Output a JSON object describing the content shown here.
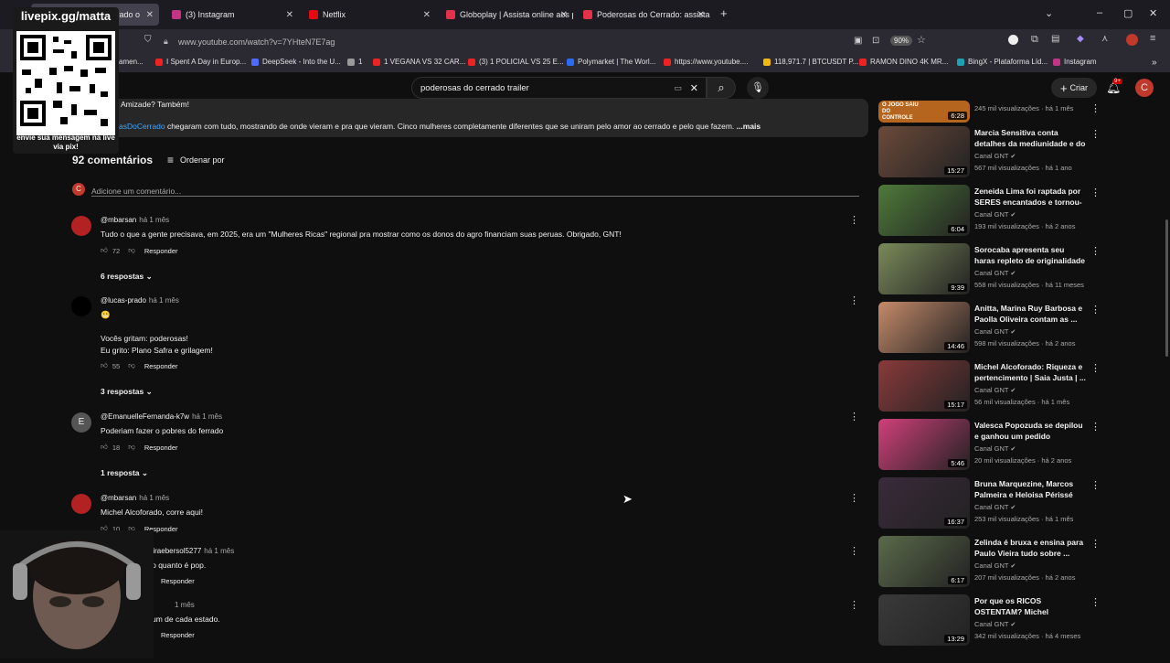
{
  "browser": {
    "tabs": [
      {
        "label": "Poderosas do Cerrado o",
        "color": "#5f5f5f",
        "active": true
      },
      {
        "label": "(3) Instagram",
        "color": "#c13584"
      },
      {
        "label": "Netflix",
        "color": "#e50914"
      },
      {
        "label": "Globoplay | Assista online aos p",
        "color": "#e1324a"
      },
      {
        "label": "Poderosas do Cerrado: assista a",
        "color": "#e1324a"
      }
    ],
    "url": "www.youtube.com/watch?v=7YHteN7E7ag",
    "zoom": "90%",
    "bookmarks": [
      "amen...",
      "I Spent A Day in Europ...",
      "DeepSeek - Into the U...",
      "1",
      "1 VEGANA VS 32 CAR...",
      "(3) 1 POLICIAL VS 25 E...",
      "Polymarket | The Worl...",
      "https://www.youtube....",
      "118,971.7 | BTCUSDT P...",
      "RAMON DINO 4K MR...",
      "BingX - Plataforma Líd...",
      "Instagram"
    ]
  },
  "youtube": {
    "search_value": "poderosas do cerrado trailer",
    "create_label": "Criar",
    "notifications": "9+",
    "avatar_letter": "C"
  },
  "description": {
    "line1": "Amizade? Também!",
    "hashtag": "asDoCerrado",
    "line2": "chegaram com tudo, mostrando de onde vieram e pra que vieram. Cinco mulheres completamente diferentes que se uniram pelo amor ao cerrado e pelo que fazem.",
    "more": "...mais"
  },
  "comments_header": {
    "count_label": "92 comentários",
    "sort_label": "Ordenar por",
    "add_placeholder": "Adicione um comentário..."
  },
  "comments": [
    {
      "author": "@mbarsan",
      "ago": "há 1 mês",
      "text": "Tudo o que a gente precisava, em 2025, era um \"Mulheres Ricas\" regional pra mostrar como os donos do agro financiam suas peruas. Obrigado, GNT!",
      "likes": "72",
      "reply": "Responder",
      "replies": "6 respostas"
    },
    {
      "author": "@lucas-prado",
      "ago": "há 1 mês",
      "text": "😬\n\nVocês gritam: poderosas!\nEu grito: Plano Safra e grilagem!",
      "likes": "55",
      "reply": "Responder",
      "replies": "3 respostas"
    },
    {
      "author": "@EmanuelleFernanda-k7w",
      "ago": "há 1 mês",
      "text": "Poderiam fazer o  pobres do ferrado",
      "likes": "18",
      "reply": "Responder",
      "replies": "1 resposta",
      "letter": "E"
    },
    {
      "author": "@mbarsan",
      "ago": "há 1 mês",
      "text": "Michel Alcoforado, corre aqui!",
      "likes": "10",
      "reply": "Responder"
    },
    {
      "author": "deoliveiraebersol5277",
      "ago": "há 1 mês",
      "text": "rando o quanto é pop.",
      "reply": "Responder"
    },
    {
      "author": "",
      "ago": "1 mês",
      "text": "um de cada estado.",
      "reply": "Responder"
    }
  ],
  "recommendations": [
    {
      "title": "O JOGO SAIU DO CONTROLE",
      "channel": "",
      "views": "245 mil visualizações · há 1 mês",
      "duration": "6:28",
      "color": "#b5651d"
    },
    {
      "title": "Marcia Sensitiva conta detalhes da mediunidade e do mundo ...",
      "channel": "Canal GNT",
      "views": "567 mil visualizações · há 1 ano",
      "duration": "15:27",
      "color": "#6b4a3a"
    },
    {
      "title": "Zeneida Lima foi raptada por SERES encantados e tornou-s...",
      "channel": "Canal GNT",
      "views": "193 mil visualizações · há 2 anos",
      "duration": "6:04",
      "color": "#4e7a3a"
    },
    {
      "title": "Sorocaba apresenta seu haras repleto de originalidade e afet...",
      "channel": "Canal GNT",
      "views": "558 mil visualizações · há 11 meses",
      "duration": "9:39",
      "color": "#7a8a5a"
    },
    {
      "title": "Anitta, Marina Ruy Barbosa e Paolla Oliveira contam as ...",
      "channel": "Canal GNT",
      "views": "598 mil visualizações · há 2 anos",
      "duration": "14:46",
      "color": "#c58a6a"
    },
    {
      "title": "Michel Alcoforado: Riqueza e pertencimento | Saia Justa | ...",
      "channel": "Canal GNT",
      "views": "56 mil visualizações · há 1 mês",
      "duration": "15:17",
      "color": "#8a3a3a"
    },
    {
      "title": "Valesca Popozuda se depilou e ganhou um pedido inusitado n...",
      "channel": "Canal GNT",
      "views": "20 mil visualizações · há 2 anos",
      "duration": "5:46",
      "color": "#d0407a"
    },
    {
      "title": "Bruna Marquezine, Marcos Palmeira e Heloisa Périssé em...",
      "channel": "Canal GNT",
      "views": "253 mil visualizações · há 1 mês",
      "duration": "16:37",
      "color": "#3a2a3a"
    },
    {
      "title": "Zelinda é bruxa e ensina para Paulo Vieira tudo sobre ...",
      "channel": "Canal GNT",
      "views": "207 mil visualizações · há 2 anos",
      "duration": "6:17",
      "color": "#5a6a4a"
    },
    {
      "title": "Por que os RICOS OSTENTAM? Michel Alcoforado TE CONTA | ...",
      "channel": "Canal GNT",
      "views": "342 mil visualizações · há 4 meses",
      "duration": "13:29",
      "color": "#3a3a3a"
    }
  ],
  "overlay": {
    "title": "livepix.gg/matta",
    "caption": "envie sua mensagem na live via pix!"
  }
}
